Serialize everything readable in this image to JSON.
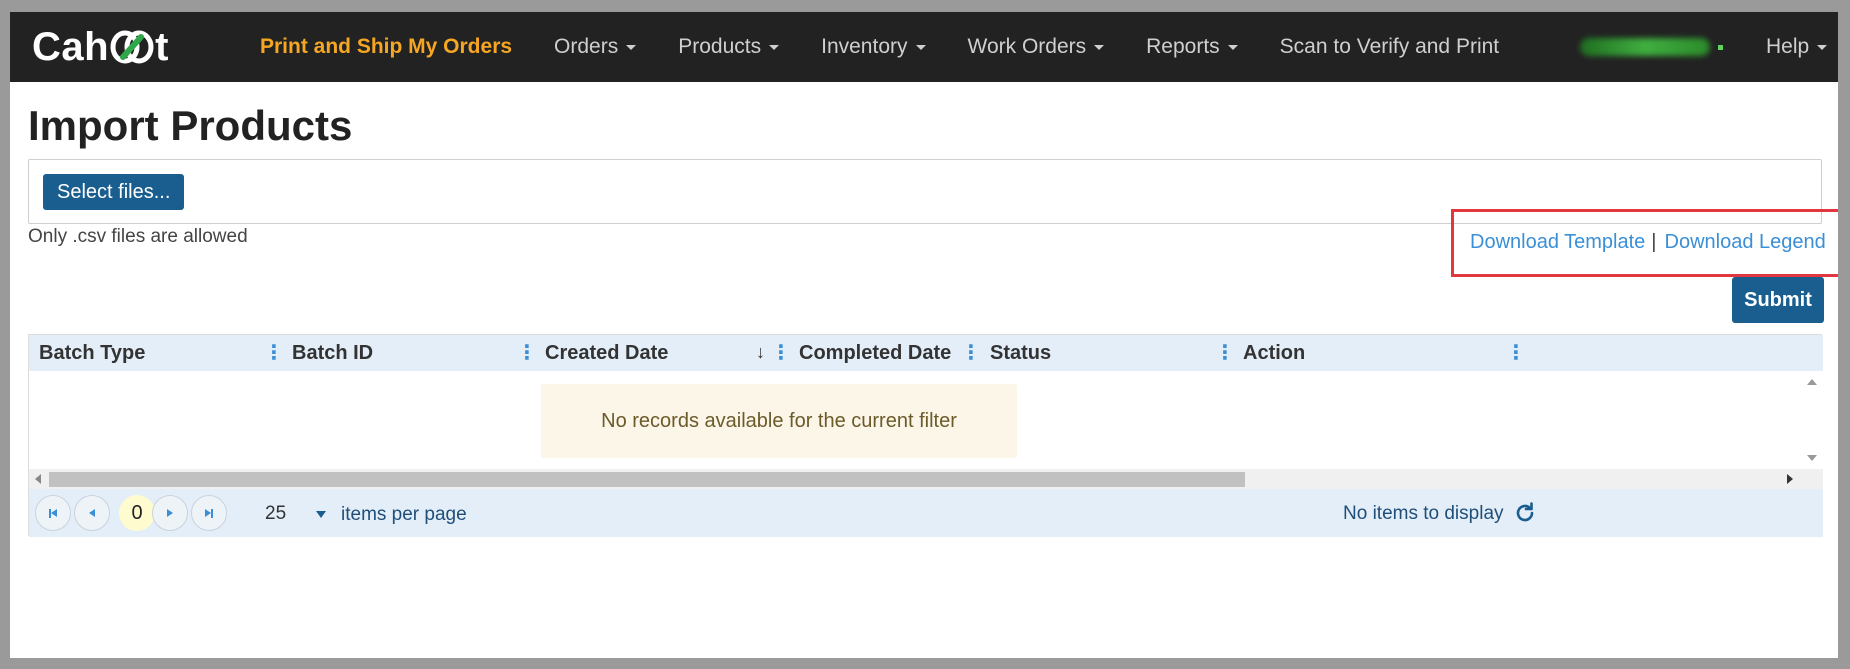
{
  "navbar": {
    "logo_text": "Cahoot",
    "items": [
      {
        "label": "Print and Ship My Orders",
        "active": true,
        "dropdown": false
      },
      {
        "label": "Orders",
        "active": false,
        "dropdown": true
      },
      {
        "label": "Products",
        "active": false,
        "dropdown": true
      },
      {
        "label": "Inventory",
        "active": false,
        "dropdown": true
      },
      {
        "label": "Work Orders",
        "active": false,
        "dropdown": true
      },
      {
        "label": "Reports",
        "active": false,
        "dropdown": true
      },
      {
        "label": "Scan to Verify and Print",
        "active": false,
        "dropdown": false
      }
    ],
    "help_label": "Help"
  },
  "page": {
    "title": "Import Products"
  },
  "upload": {
    "select_label": "Select files...",
    "hint": "Only .csv files are allowed"
  },
  "downloads": {
    "template_label": "Download Template",
    "separator": "|",
    "legend_label": "Download Legend"
  },
  "submit_label": "Submit",
  "grid": {
    "columns": [
      {
        "label": "Batch Type"
      },
      {
        "label": "Batch ID"
      },
      {
        "label": "Created Date",
        "sorted": "desc"
      },
      {
        "label": "Completed Date"
      },
      {
        "label": "Status"
      },
      {
        "label": "Action"
      }
    ],
    "empty_message": "No records available for the current filter"
  },
  "pager": {
    "current_page": "0",
    "page_size": "25",
    "per_page_label": "items per page",
    "status": "No items to display"
  },
  "colors": {
    "navbar_bg": "#222222",
    "active_nav": "#f5a623",
    "primary_button": "#1a5d8f",
    "link": "#3a8fd6",
    "highlight_box": "#e0383e",
    "grid_header": "#e4eef8"
  }
}
